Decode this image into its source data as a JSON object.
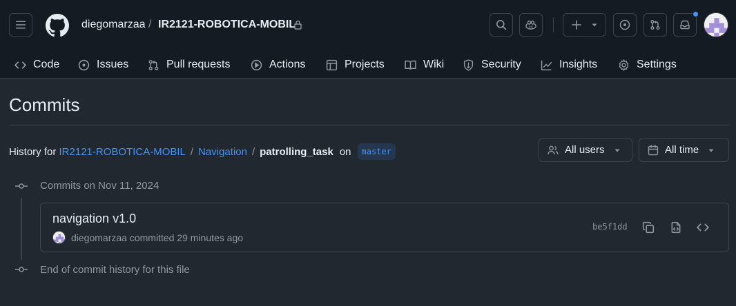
{
  "header": {
    "owner": "diegomarzaa",
    "separator": "/",
    "repo": "IR2121-ROBOTICA-MOBIL"
  },
  "tabs": [
    {
      "label": "Code",
      "icon": "code-icon"
    },
    {
      "label": "Issues",
      "icon": "issue-opened-icon"
    },
    {
      "label": "Pull requests",
      "icon": "git-pull-request-icon"
    },
    {
      "label": "Actions",
      "icon": "play-icon"
    },
    {
      "label": "Projects",
      "icon": "table-icon"
    },
    {
      "label": "Wiki",
      "icon": "book-icon"
    },
    {
      "label": "Security",
      "icon": "shield-icon"
    },
    {
      "label": "Insights",
      "icon": "graph-icon"
    },
    {
      "label": "Settings",
      "icon": "gear-icon"
    }
  ],
  "page": {
    "title": "Commits",
    "history_prefix": "History for",
    "path": [
      "IR2121-ROBOTICA-MOBIL",
      "Navigation",
      "patrolling_task"
    ],
    "path_separator": "/",
    "on_label": "on",
    "branch": "master"
  },
  "filters": {
    "users_label": "All users",
    "time_label": "All time"
  },
  "commit_groups": [
    {
      "label": "Commits on Nov 11, 2024",
      "commits": [
        {
          "title": "navigation v1.0",
          "author": "diegomarzaa",
          "action": "committed",
          "time": "29 minutes ago",
          "sha": "be5f1dd"
        }
      ]
    }
  ],
  "end_label": "End of commit history for this file",
  "colors": {
    "accent": "#4493f8",
    "bg": "#212830",
    "header_bg": "#151b23",
    "border": "#3d444d",
    "muted": "#9198a1"
  }
}
